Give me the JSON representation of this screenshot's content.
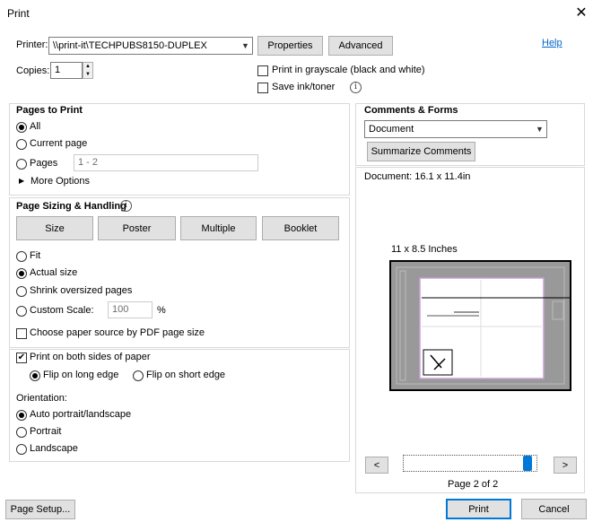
{
  "window": {
    "title": "Print",
    "close_glyph": "✕"
  },
  "printer": {
    "label": "Printer:",
    "selected": "\\\\print-it\\TECHPUBS8150-DUPLEX",
    "properties_label": "Properties",
    "advanced_label": "Advanced",
    "help_label": "Help"
  },
  "copies": {
    "label": "Copies:",
    "value": "1"
  },
  "options": {
    "grayscale_label": "Print in grayscale (black and white)",
    "grayscale_checked": false,
    "save_ink_label": "Save ink/toner",
    "save_ink_checked": false
  },
  "pages_to_print": {
    "heading": "Pages to Print",
    "all_label": "All",
    "current_label": "Current page",
    "pages_label": "Pages",
    "pages_value": "1 - 2",
    "more_options_label": "More Options",
    "selected": "All"
  },
  "sizing": {
    "heading": "Page Sizing & Handling",
    "tabs": [
      "Size",
      "Poster",
      "Multiple",
      "Booklet"
    ],
    "selected_tab": "Size",
    "fit_label": "Fit",
    "actual_label": "Actual size",
    "shrink_label": "Shrink oversized pages",
    "custom_label": "Custom Scale:",
    "custom_value": "100",
    "percent": "%",
    "paper_source_label": "Choose paper source by PDF page size",
    "selected": "Actual size"
  },
  "duplex": {
    "both_sides_label": "Print on both sides of paper",
    "both_sides_checked": true,
    "long_edge_label": "Flip on long edge",
    "short_edge_label": "Flip on short edge",
    "selected": "Flip on long edge"
  },
  "orientation": {
    "heading": "Orientation:",
    "auto_label": "Auto portrait/landscape",
    "portrait_label": "Portrait",
    "landscape_label": "Landscape",
    "selected": "Auto portrait/landscape"
  },
  "comments": {
    "heading": "Comments & Forms",
    "selected": "Document",
    "summarize_label": "Summarize Comments"
  },
  "preview": {
    "document_size": "Document: 16.1 x 11.4in",
    "paper_size": "11 x 8.5 Inches",
    "prev_glyph": "<",
    "next_glyph": ">",
    "page_indicator": "Page 2 of 2",
    "slider_position": 1.0
  },
  "footer": {
    "page_setup_label": "Page Setup...",
    "print_label": "Print",
    "cancel_label": "Cancel"
  }
}
